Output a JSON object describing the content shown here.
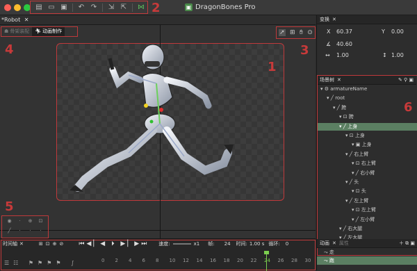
{
  "window": {
    "title": "DragonBones Pro",
    "logo_glyph": "▣"
  },
  "document_tab": {
    "label": "*Robot",
    "close_glyph": "✕"
  },
  "annotations": [
    "1",
    "2",
    "3",
    "4",
    "5",
    "6"
  ],
  "modes": [
    {
      "label": "骨架装配",
      "icon": "rig-icon",
      "active": false
    },
    {
      "label": "动画制作",
      "icon": "animate-icon",
      "active": true
    }
  ],
  "transform": {
    "title": "变换",
    "x_label": "X",
    "x_value": "60.37",
    "y_label": "Y",
    "y_value": "0.00",
    "rotation_value": "40.60",
    "scale_x_value": "1.00",
    "scale_y_value": "1.00"
  },
  "scene_tree": {
    "title": "场景树",
    "items": [
      {
        "label": "armatureName",
        "indent": 0,
        "icon": "armature-icon",
        "selected": false
      },
      {
        "label": "root",
        "indent": 1,
        "icon": "bone-icon",
        "selected": false
      },
      {
        "label": "胯",
        "indent": 2,
        "icon": "bone-icon",
        "selected": false
      },
      {
        "label": "胯",
        "indent": 3,
        "icon": "slot-icon",
        "selected": false
      },
      {
        "label": "上身",
        "indent": 3,
        "icon": "bone-icon",
        "selected": true
      },
      {
        "label": "上身",
        "indent": 4,
        "icon": "slot-icon",
        "selected": false
      },
      {
        "label": "上身",
        "indent": 5,
        "icon": "image-icon",
        "selected": false
      },
      {
        "label": "右上臂",
        "indent": 4,
        "icon": "bone-icon",
        "selected": false
      },
      {
        "label": "右上臂",
        "indent": 5,
        "icon": "slot-icon",
        "selected": false
      },
      {
        "label": "右小臂",
        "indent": 5,
        "icon": "bone-icon",
        "selected": false
      },
      {
        "label": "头",
        "indent": 4,
        "icon": "bone-icon",
        "selected": false
      },
      {
        "label": "头",
        "indent": 5,
        "icon": "slot-icon",
        "selected": false
      },
      {
        "label": "左上臂",
        "indent": 4,
        "icon": "bone-icon",
        "selected": false
      },
      {
        "label": "左上臂",
        "indent": 5,
        "icon": "slot-icon",
        "selected": false
      },
      {
        "label": "左小臂",
        "indent": 5,
        "icon": "bone-icon",
        "selected": false
      },
      {
        "label": "右大腿",
        "indent": 3,
        "icon": "bone-icon",
        "selected": false
      },
      {
        "label": "左大腿",
        "indent": 3,
        "icon": "bone-icon",
        "selected": false
      }
    ]
  },
  "animation_panel": {
    "title": "动画",
    "properties_tab": "属性",
    "items": [
      {
        "label": "走",
        "selected": false
      },
      {
        "label": "跑",
        "selected": true
      }
    ]
  },
  "timeline": {
    "title": "时间轴",
    "speed_label": "速度:",
    "speed_value": "x1",
    "fps_label": "帧:",
    "fps_value": "24",
    "time_label": "时间:",
    "time_value": "1.00 s",
    "loops_label": "循环:",
    "loops_value": "0",
    "ruler": [
      "0",
      "2",
      "4",
      "6",
      "8",
      "10",
      "12",
      "14",
      "16",
      "18",
      "20",
      "22",
      "24",
      "26",
      "28",
      "30"
    ],
    "current_frame": "24"
  },
  "colors": {
    "accent_red": "#c0393b",
    "selection_green": "#5b7f62",
    "playhead": "#7ccf4f"
  }
}
